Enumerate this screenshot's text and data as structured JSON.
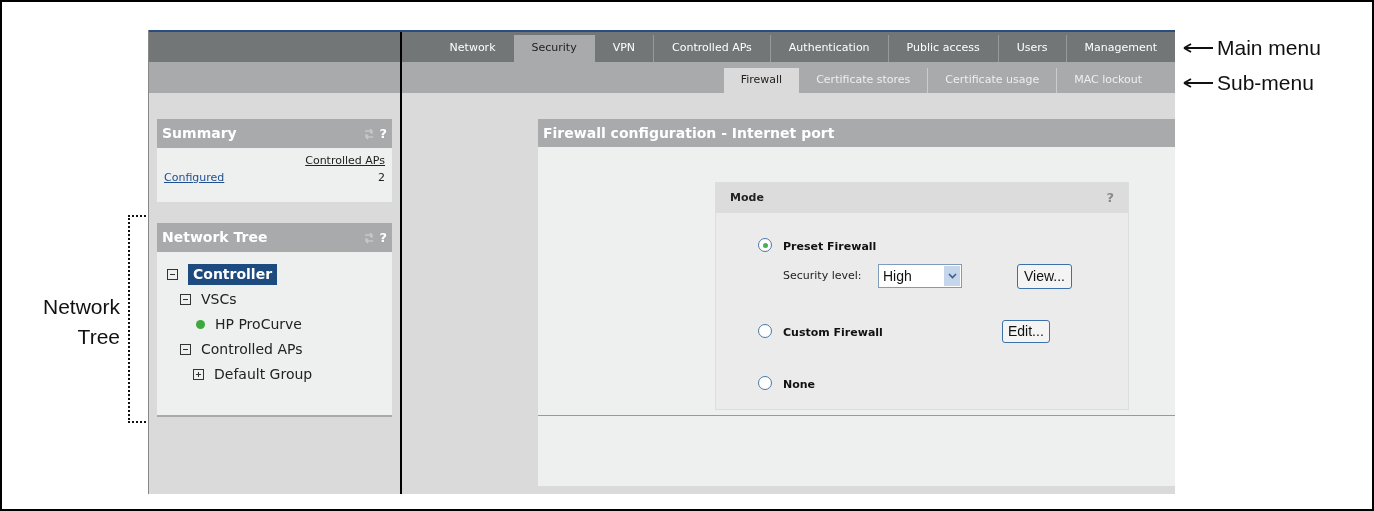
{
  "main_menu": [
    {
      "label": "Network",
      "selected": false
    },
    {
      "label": "Security",
      "selected": true
    },
    {
      "label": "VPN",
      "selected": false
    },
    {
      "label": "Controlled APs",
      "selected": false
    },
    {
      "label": "Authentication",
      "selected": false
    },
    {
      "label": "Public access",
      "selected": false
    },
    {
      "label": "Users",
      "selected": false
    },
    {
      "label": "Management",
      "selected": false
    }
  ],
  "sub_menu": [
    {
      "label": "Firewall",
      "selected": true
    },
    {
      "label": "Certificate stores",
      "selected": false
    },
    {
      "label": "Certificate usage",
      "selected": false
    },
    {
      "label": "MAC lockout",
      "selected": false
    }
  ],
  "summary": {
    "title": "Summary",
    "help": "?",
    "column": "Controlled APs",
    "rows": [
      {
        "label": "Configured",
        "value": "2"
      }
    ]
  },
  "network_tree": {
    "title": "Network Tree",
    "help": "?",
    "items": [
      {
        "label": "Controller",
        "kind": "folder",
        "expanded": true,
        "selected": true,
        "children": [
          {
            "label": "VSCs",
            "kind": "folder",
            "expanded": true,
            "selected": false,
            "children": [
              {
                "label": "HP ProCurve",
                "kind": "device",
                "color": "#3ea83e",
                "selected": false
              }
            ]
          },
          {
            "label": "Controlled APs",
            "kind": "folder",
            "expanded": true,
            "selected": false,
            "children": [
              {
                "label": "Default Group",
                "kind": "folder",
                "expanded": false,
                "selected": false
              }
            ]
          }
        ]
      }
    ]
  },
  "panel": {
    "title": "Firewall configuration - Internet port",
    "mode": {
      "title": "Mode",
      "help": "?",
      "options": [
        {
          "label": "Preset Firewall",
          "selected": true,
          "security_level": {
            "label": "Security level:",
            "value": "High"
          },
          "button": "View..."
        },
        {
          "label": "Custom Firewall",
          "selected": false,
          "button": "Edit..."
        },
        {
          "label": "None",
          "selected": false
        }
      ]
    }
  },
  "annotations": {
    "main_menu": "Main menu",
    "sub_menu": "Sub-menu",
    "network_tree": "Network Tree"
  }
}
